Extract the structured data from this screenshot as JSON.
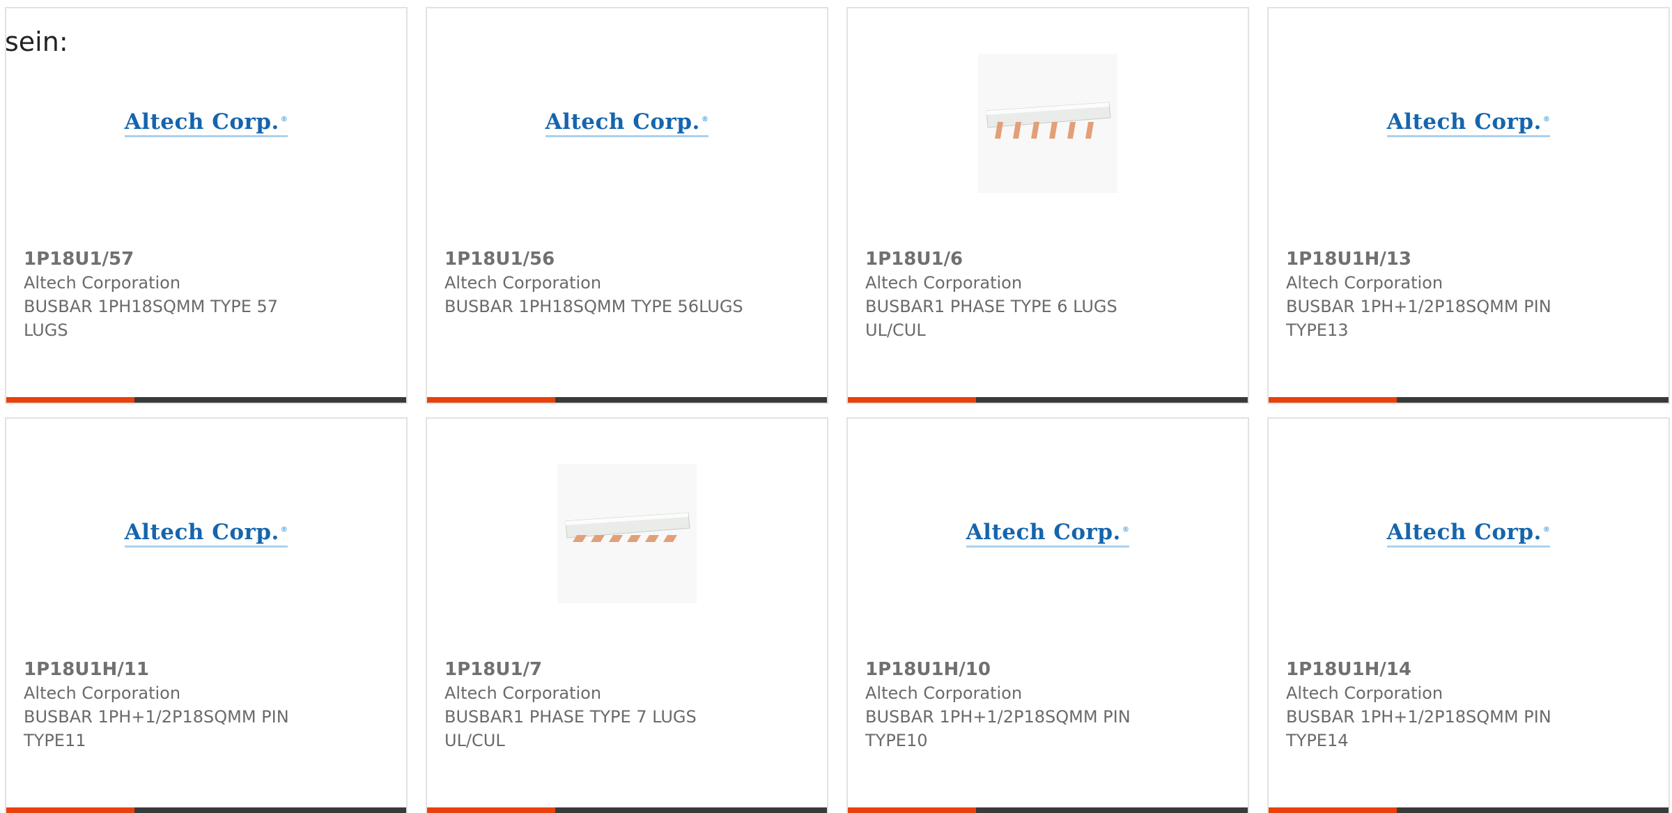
{
  "intro_text": "sein:",
  "accent_color": "#e8410e",
  "bar_color": "#3a3a3a",
  "logo_text": "Altech Corp.",
  "logo_reg": "®",
  "products": [
    {
      "part": "1P18U1/57",
      "maker": "Altech Corporation",
      "desc": "BUSBAR 1PH18SQMM TYPE 57 LUGS",
      "image": "altech-logo"
    },
    {
      "part": "1P18U1/56",
      "maker": "Altech Corporation",
      "desc": "BUSBAR 1PH18SQMM TYPE 56LUGS",
      "image": "altech-logo"
    },
    {
      "part": "1P18U1/6",
      "maker": "Altech Corporation",
      "desc": "BUSBAR1 PHASE TYPE 6 LUGS UL/CUL",
      "image": "busbar-photo"
    },
    {
      "part": "1P18U1H/13",
      "maker": "Altech Corporation",
      "desc": "BUSBAR 1PH+1/2P18SQMM PIN TYPE13",
      "image": "altech-logo"
    },
    {
      "part": "1P18U1H/11",
      "maker": "Altech Corporation",
      "desc": "BUSBAR 1PH+1/2P18SQMM PIN TYPE11",
      "image": "altech-logo"
    },
    {
      "part": "1P18U1/7",
      "maker": "Altech Corporation",
      "desc": "BUSBAR1 PHASE TYPE 7 LUGS UL/CUL",
      "image": "busbar-photo"
    },
    {
      "part": "1P18U1H/10",
      "maker": "Altech Corporation",
      "desc": "BUSBAR 1PH+1/2P18SQMM PIN TYPE10",
      "image": "altech-logo"
    },
    {
      "part": "1P18U1H/14",
      "maker": "Altech Corporation",
      "desc": "BUSBAR 1PH+1/2P18SQMM PIN TYPE14",
      "image": "altech-logo"
    }
  ]
}
